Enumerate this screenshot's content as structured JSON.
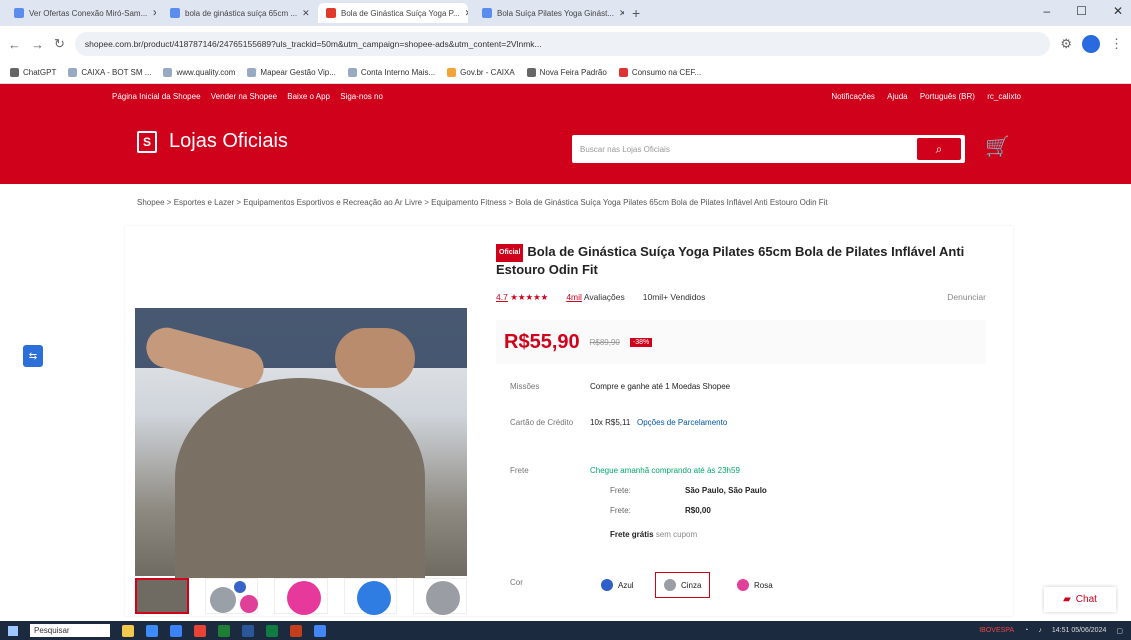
{
  "browser": {
    "tabs": [
      {
        "label": "Ver Ofertas Conexão Miró-Sam...",
        "active": false
      },
      {
        "label": "bola de ginástica suíça 65cm ...",
        "active": false
      },
      {
        "label": "Bola de Ginástica Suíça Yoga P...",
        "active": true
      },
      {
        "label": "Bola Suíça Pilates Yoga Ginást...",
        "active": false
      }
    ],
    "url": "shopee.com.br/product/418787146/24765155689?uls_trackid=50m&utm_campaign=shopee-ads&utm_content=2Vlnmk...",
    "bookmarks": [
      "ChatGPT",
      "CAIXA - BOT SM ...",
      "www.quality.com",
      "Mapear Gestão Vip...",
      "Conta Interno Mais...",
      "Gov.br - CAIXA",
      "Nova Feira Padrão",
      "Consumo na CEF..."
    ]
  },
  "shopee": {
    "topnav_left": [
      "Página Inicial da Shopee",
      "Vender na Shopee",
      "Baixe o App",
      "Siga-nos no"
    ],
    "topnav_right": [
      "Notificações",
      "Ajuda",
      "Português (BR)",
      "rc_calixto"
    ],
    "brand": "Lojas Oficiais",
    "search_placeholder": "Buscar nas Lojas Oficiais"
  },
  "breadcrumb": "Shopee > Esportes e Lazer > Equipamentos Esportivos e Recreação ao Ar Livre > Equipamento Fitness > Bola de Ginástica Suíça Yoga Pilates 65cm Bola de Pilates Inflável Anti Estouro Odin Fit",
  "product": {
    "tag": "Oficial",
    "title": "Bola de Ginástica Suíça Yoga Pilates 65cm Bola de Pilates Inflável Anti Estouro Odin Fit",
    "rating": "4.7",
    "stars": "★★★★★",
    "reviews": "4mil",
    "reviews_label": "Avaliações",
    "sold": "10mil+",
    "sold_label": "Vendidos",
    "report": "Denunciar",
    "price": "R$55,90",
    "old_price": "R$89,90",
    "discount": "-38%",
    "missao_label": "Missões",
    "missao_value": "Compre e ganhe até 1 Moedas Shopee",
    "cartao_label": "Cartão de Crédito",
    "cartao_value": "10x R$5,11",
    "cartao_link": "Opções de Parcelamento",
    "frete_label": "Frete",
    "frete_value": "Chegue amanhã comprando até às 23h59",
    "frete_para_label": "Frete:",
    "frete_para_value": "São Paulo, São Paulo",
    "frete_valor_label": "Frete:",
    "frete_valor_value": "R$0,00",
    "frete_gratis": "Frete grátis",
    "frete_gratis_note": "sem cupom",
    "cor_label": "Cor",
    "colors": [
      "Azul",
      "Cinza",
      "Rosa"
    ]
  },
  "chat_label": "Chat",
  "taskbar": {
    "search": "Pesquisar",
    "ticker": "IBOVESPA",
    "time": "14:51",
    "date": "05/06/2024"
  }
}
